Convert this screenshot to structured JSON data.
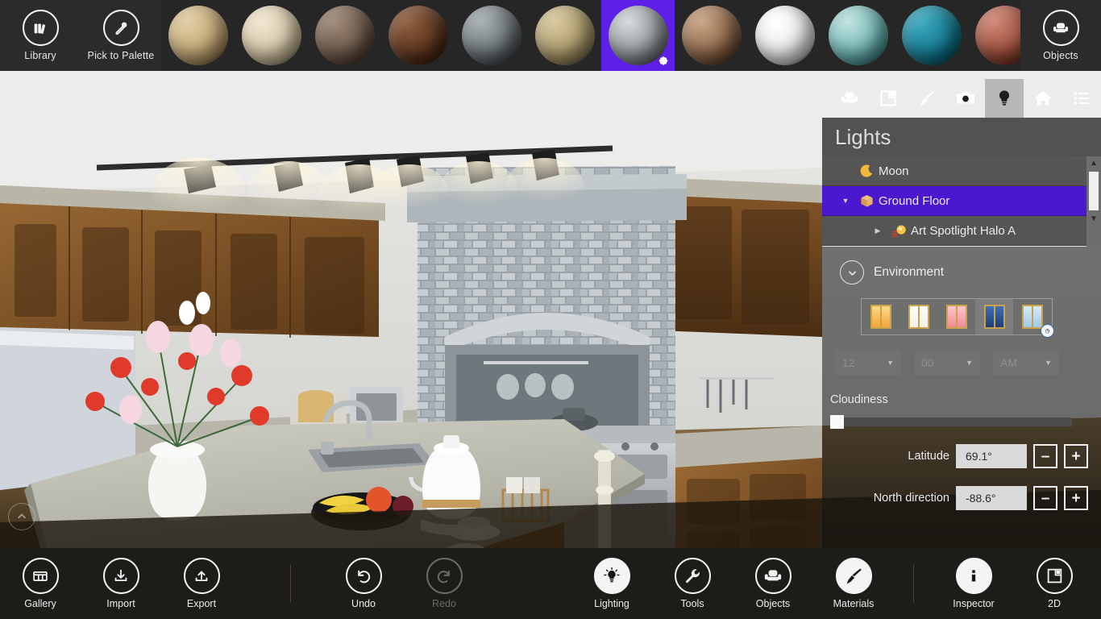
{
  "topbar": {
    "library": {
      "label": "Library",
      "icon": "books-icon"
    },
    "pick": {
      "label": "Pick to Palette",
      "icon": "eyedropper-icon"
    },
    "objects": {
      "label": "Objects",
      "icon": "sofa-icon"
    },
    "swatches": [
      {
        "name": "light-wood",
        "c1": "#e2cda2",
        "c2": "#b89a68",
        "selected": false
      },
      {
        "name": "cream-plaster",
        "c1": "#f0e6cf",
        "c2": "#cdbd9c",
        "selected": false
      },
      {
        "name": "grey-wood-plank",
        "c1": "#9d8877",
        "c2": "#5f4b3c",
        "selected": false
      },
      {
        "name": "dark-wood-plank",
        "c1": "#8e5b3c",
        "c2": "#512c17",
        "selected": false
      },
      {
        "name": "grey-brick",
        "c1": "#a8b0b4",
        "c2": "#565f63",
        "selected": false
      },
      {
        "name": "sand-stucco",
        "c1": "#d8c89a",
        "c2": "#9d8c5e",
        "selected": false
      },
      {
        "name": "grey-shingle",
        "c1": "#d6d8da",
        "c2": "#7e8488",
        "selected": true
      },
      {
        "name": "woven-wood",
        "c1": "#c9a484",
        "c2": "#7a5337",
        "selected": false
      },
      {
        "name": "white-gloss",
        "c1": "#ffffff",
        "c2": "#e3e3e3",
        "selected": false
      },
      {
        "name": "teal-marble",
        "c1": "#bfe3e0",
        "c2": "#56a7a5",
        "selected": false
      },
      {
        "name": "teal-carpet",
        "c1": "#3ba7bd",
        "c2": "#0b6f86",
        "selected": false
      },
      {
        "name": "red-brick",
        "c1": "#d08673",
        "c2": "#8a3c2c",
        "selected": false
      },
      {
        "name": "pale-blue",
        "c1": "#eef2f4",
        "c2": "#b7c2c8",
        "selected": false
      }
    ],
    "selected_swatch_gear": "gear-icon"
  },
  "viewport": {
    "collapse_icon": "chevron-up-icon",
    "scene_description": "3D kitchen interior render"
  },
  "rightpanel": {
    "icons": [
      {
        "name": "objects-icon",
        "glyph": "sofa",
        "active": false
      },
      {
        "name": "floorplan-2d-icon",
        "glyph": "plan",
        "active": false
      },
      {
        "name": "materials-brush-icon",
        "glyph": "brush",
        "active": false
      },
      {
        "name": "camera-icon",
        "glyph": "camera",
        "active": false
      },
      {
        "name": "lighting-bulb-icon",
        "glyph": "bulb",
        "active": true
      },
      {
        "name": "home-icon",
        "glyph": "home",
        "active": false
      },
      {
        "name": "menu-list-icon",
        "glyph": "list",
        "active": false
      }
    ],
    "title": "Lights",
    "tree": [
      {
        "label": "Moon",
        "icon": "moon-icon",
        "twisty": "",
        "selected": false,
        "indent": 0
      },
      {
        "label": "Ground Floor",
        "icon": "box-icon",
        "twisty": "▼",
        "selected": true,
        "indent": 0
      },
      {
        "label": "Art Spotlight Halo A",
        "icon": "spotlight-icon",
        "twisty": "▶",
        "selected": false,
        "indent": 1
      }
    ],
    "environment": {
      "label": "Environment",
      "chevron": "chevron-down-icon",
      "presets": [
        {
          "name": "preset-sunrise",
          "selected": false,
          "pane": "#f3a63a",
          "glow": "#ffd98a"
        },
        {
          "name": "preset-daylight",
          "selected": false,
          "pane": "#f2f0e6",
          "glow": "#ffffff"
        },
        {
          "name": "preset-sunset",
          "selected": false,
          "pane": "#f08a96",
          "glow": "#ffc6cc"
        },
        {
          "name": "preset-night",
          "selected": true,
          "pane": "#1c3d78",
          "glow": "#3f6fb5"
        },
        {
          "name": "preset-custom-time",
          "selected": false,
          "pane": "#9ec8e8",
          "glow": "#d6ecfa",
          "badge": "clock-icon"
        }
      ],
      "time": {
        "hour": "12",
        "minute": "00",
        "meridiem": "AM",
        "chevron": "chevron-down-icon"
      },
      "cloudiness": {
        "label": "Cloudiness",
        "value": 0
      },
      "latitude": {
        "label": "Latitude",
        "value": "69.1°",
        "minus": "–",
        "plus": "+"
      },
      "north": {
        "label": "North direction",
        "value": "-88.6°",
        "minus": "–",
        "plus": "+"
      }
    }
  },
  "bottombar": {
    "items": [
      {
        "name": "gallery-button",
        "label": "Gallery",
        "icon": "gallery-icon",
        "style": "outline"
      },
      {
        "name": "import-button",
        "label": "Import",
        "icon": "import-icon",
        "style": "outline"
      },
      {
        "name": "export-button",
        "label": "Export",
        "icon": "export-icon",
        "style": "outline"
      },
      {
        "name": "undo-button",
        "label": "Undo",
        "icon": "undo-icon",
        "style": "outline"
      },
      {
        "name": "redo-button",
        "label": "Redo",
        "icon": "redo-icon",
        "style": "disabled"
      },
      {
        "name": "lighting-button",
        "label": "Lighting",
        "icon": "bulb-icon",
        "style": "filled"
      },
      {
        "name": "tools-button",
        "label": "Tools",
        "icon": "wrench-icon",
        "style": "outline"
      },
      {
        "name": "objects-button",
        "label": "Objects",
        "icon": "sofa-icon",
        "style": "outline"
      },
      {
        "name": "materials-button",
        "label": "Materials",
        "icon": "brush-icon",
        "style": "filled"
      },
      {
        "name": "inspector-button",
        "label": "Inspector",
        "icon": "info-icon",
        "style": "filled"
      },
      {
        "name": "twod-button",
        "label": "2D",
        "icon": "floorplan-icon",
        "style": "outline"
      }
    ]
  }
}
